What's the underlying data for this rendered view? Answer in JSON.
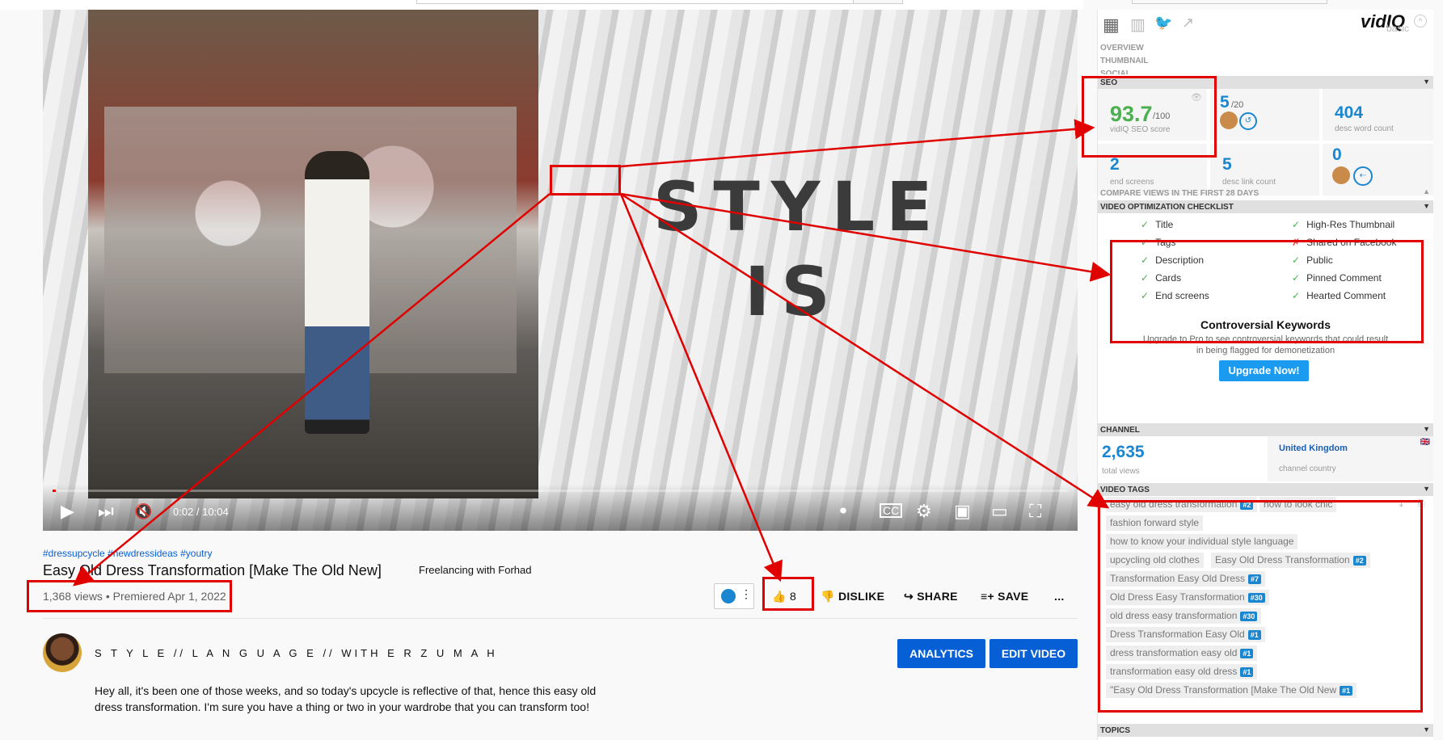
{
  "video": {
    "overlay_line1": "STYLE",
    "overlay_line2": "IS",
    "time": "0:02 / 10:04",
    "progress_fraction": 0.003
  },
  "hashtags": "#dressupcycle #newdressideas #youtry",
  "title": "Easy Old Dress Transformation [Make The Old New]",
  "watermark_text": "Freelancing with Forhad",
  "views": "1,368 views • Premiered Apr 1, 2022",
  "actions": {
    "likes": "8",
    "dislike": "DISLIKE",
    "share": "SHARE",
    "save": "SAVE",
    "more": "..."
  },
  "channel": {
    "name": "S T Y L E // L A N G U A G E // WITH E R Z U M A H",
    "analytics_label": "ANALYTICS",
    "edit_label": "EDIT VIDEO"
  },
  "description": "Hey all, it's been one of those weeks, and so today's upcycle is reflective of that, hence this easy old dress transformation. I'm sure you have a thing or two in your wardrobe that you can transform too!",
  "vidiq": {
    "logo": "vidIQ",
    "plan": "basic",
    "menu": [
      "OVERVIEW",
      "THUMBNAIL",
      "SOCIAL"
    ],
    "seo_header": "SEO",
    "seo_score": "93.7",
    "seo_max": "/100",
    "seo_label": "vidIQ SEO score",
    "tags_count": "5",
    "tags_max": "/20",
    "desc_words": "404",
    "desc_words_label": "desc word count",
    "end_screens": "2",
    "end_screens_label": "end screens",
    "desc_links": "5",
    "desc_links_label": "desc link count",
    "cards": "0",
    "compare_header": "COMPARE VIEWS IN THE FIRST 28 DAYS",
    "checklist_header": "VIDEO OPTIMIZATION CHECKLIST",
    "checklist_left": [
      "Title",
      "Tags",
      "Description",
      "Cards",
      "End screens"
    ],
    "checklist_right": [
      "High-Res Thumbnail",
      "Shared on Facebook",
      "Public",
      "Pinned Comment",
      "Hearted Comment"
    ],
    "controversial_title": "Controversial Keywords",
    "controversial_text": "Upgrade to Pro to see controversial keywords that could result in being flagged for demonetization",
    "upgrade_label": "Upgrade Now!",
    "channel_header": "CHANNEL",
    "total_views": "2,635",
    "total_views_label": "total views",
    "country": "United Kingdom",
    "country_label": "channel country",
    "tags_header": "VIDEO TAGS",
    "tags": [
      {
        "text": "easy old dress transformation",
        "rank": "#2"
      },
      {
        "text": "how to look chic",
        "rank": ""
      },
      {
        "text": "fashion forward style",
        "rank": ""
      },
      {
        "text": "how to know your individual style language",
        "rank": ""
      },
      {
        "text": "upcycling old clothes",
        "rank": ""
      },
      {
        "text": "Easy Old Dress Transformation",
        "rank": "#2"
      },
      {
        "text": "Transformation Easy Old Dress",
        "rank": "#7"
      },
      {
        "text": "Old Dress Easy Transformation",
        "rank": "#30"
      },
      {
        "text": "old dress easy transformation",
        "rank": "#30"
      },
      {
        "text": "Dress Transformation Easy Old",
        "rank": "#1"
      },
      {
        "text": "dress transformation easy old",
        "rank": "#1"
      },
      {
        "text": "transformation easy old dress",
        "rank": "#1"
      },
      {
        "text": "\"Easy Old Dress Transformation [Make The Old New",
        "rank": "#1"
      }
    ],
    "topics_header": "TOPICS"
  },
  "colors": {
    "accent": "#065fd4",
    "annotation": "#e00000",
    "vidiq_blue": "#1a86d0",
    "seo_green": "#4caf50"
  }
}
